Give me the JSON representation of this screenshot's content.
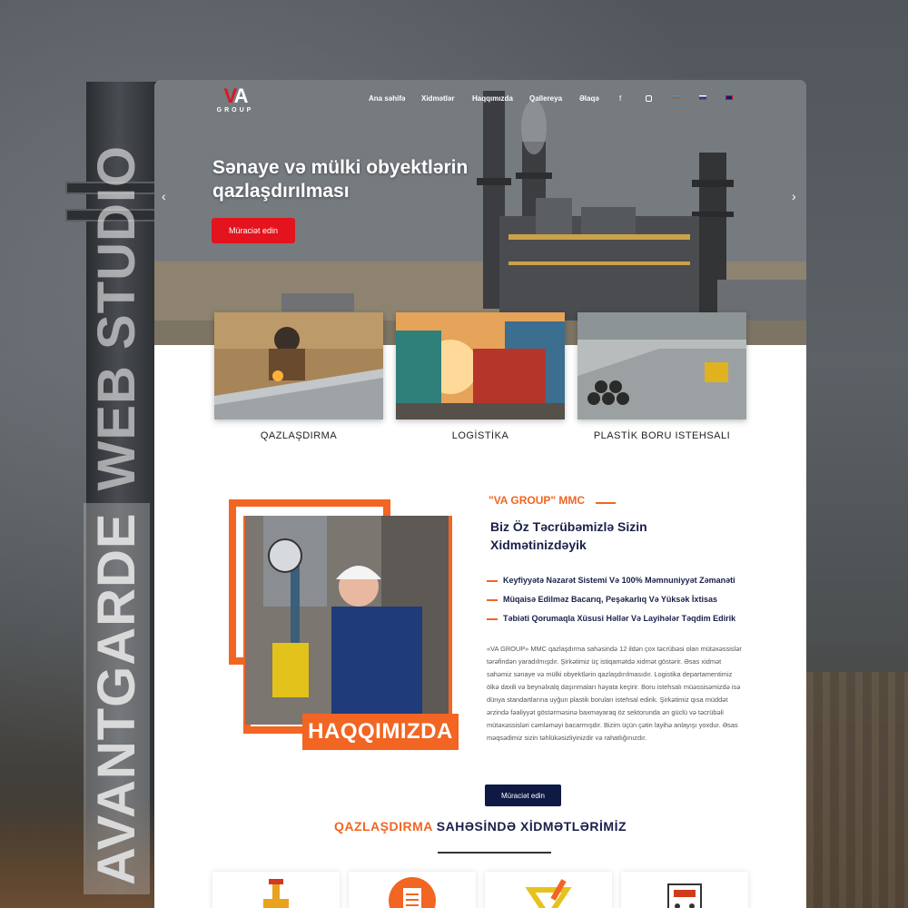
{
  "watermark": {
    "part1": "AVANTGARDE",
    "part2": "WEB STUDIO"
  },
  "logo": {
    "mark": "VA",
    "sub": "GROUP"
  },
  "nav": {
    "items": [
      "Ana səhifə",
      "Xidmətlər",
      "Haqqımızda",
      "Qallereya",
      "Əlaqə"
    ],
    "social": [
      "facebook-icon",
      "instagram-icon"
    ],
    "flags": [
      "az-flag",
      "ru-flag",
      "en-flag"
    ]
  },
  "hero": {
    "title": "Sənaye və mülki obyektlərin qazlaşdırılması",
    "button": "Müraciət edin",
    "prev": "‹",
    "next": "›"
  },
  "services": [
    {
      "label": "QAZLAŞDIRMA"
    },
    {
      "label": "LOGİSTİKA"
    },
    {
      "label": "PLASTİK BORU ISTEHSALI"
    }
  ],
  "about": {
    "banner": "HAQQIMIZDA",
    "brand": "\"VA GROUP\" MMC",
    "title": "Biz Öz Təcrübəmizlə Sizin Xidmətinizdəyik",
    "features": [
      "Keyfiyyətə Nəzarət Sistemi Və 100% Məmnuniyyət Zəmanəti",
      "Müqaisə Edilməz Bacarıq, Peşəkarlıq Və Yüksək İxtisas",
      "Təbiəti Qorumaqla Xüsusi Həllər Və Layihələr Təqdim Edirik"
    ],
    "text": "«VA GROUP» MMC qazlaşdırma sahəsində 12 ildən çox təcrübəsi olan mütəxəssislər tərəfindən yaradılmışdır. Şirkətimiz üç istiqamətdə xidmət göstərir. Əsas xidmət sahəmiz sənaye və mülki obyektlərin qazlaşdırılmasıdır. Logistika departamentimiz ölkə daxili və beynəlxalq daşınmaları həyata keçirir. Boru istehsalı müəssisəmizdə isə dünya standartlarına uyğun plastik boruları istehsal edirik. Şirkətimiz qısa müddət ərzində fəaliyyət göstərməsinə baxmayaraq öz sektorunda ən güclü və təcrübəli mütəxəssisləri cəmləməyi bacarmışdır. Bizim üçün çətin layihə anlayışı yoxdur. Əsas məqsədimiz sizin təhlükəsizliyinizdir və rahatlığınızdır.",
    "button": "Müraciət edin"
  },
  "section": {
    "title_orange": "QAZLAŞDIRMA",
    "title_dark": "SAHƏSİNDƏ XİDMƏTLƏRİMİZ"
  },
  "colors": {
    "accent": "#f26522",
    "red": "#e3141e",
    "navy": "#0f1a44"
  }
}
